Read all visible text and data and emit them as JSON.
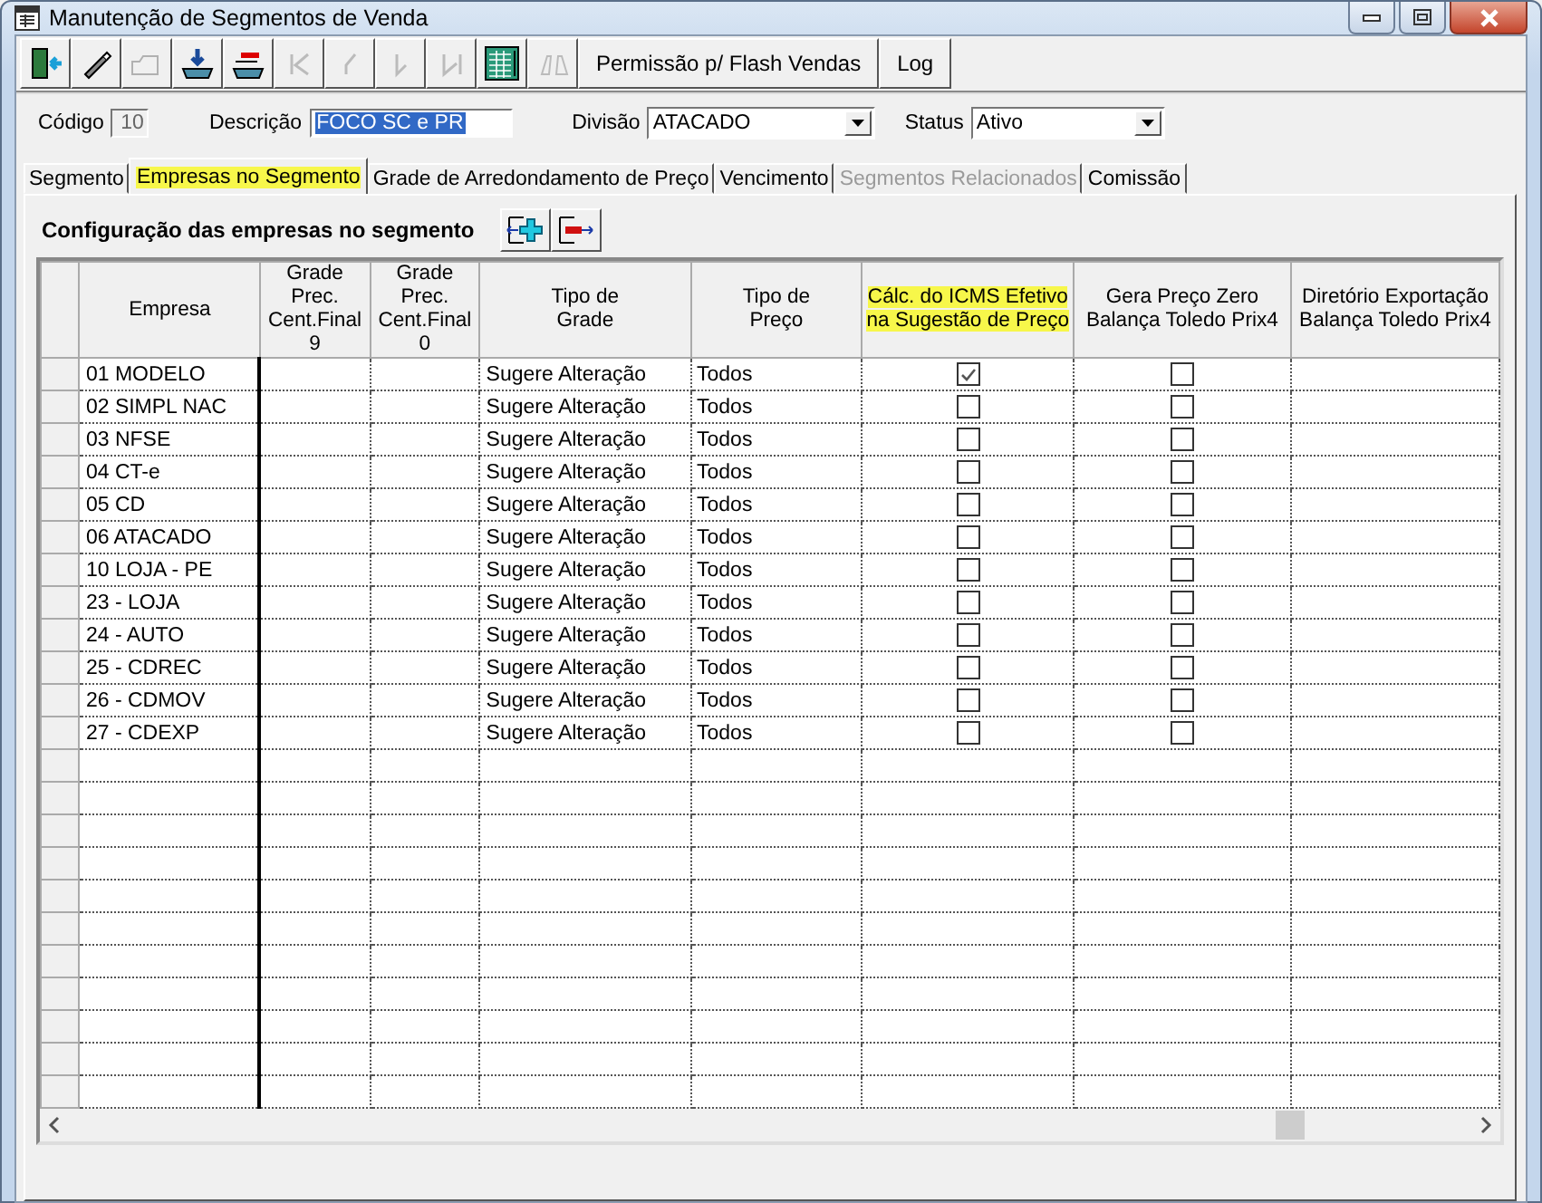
{
  "window": {
    "title": "Manutenção de Segmentos de Venda"
  },
  "toolbar": [
    {
      "kind": "icon",
      "disabled": false
    },
    {
      "kind": "icon",
      "disabled": false
    },
    {
      "kind": "icon",
      "disabled": true
    },
    {
      "kind": "icon",
      "disabled": false
    },
    {
      "kind": "icon",
      "disabled": false
    },
    {
      "kind": "icon",
      "disabled": true
    },
    {
      "kind": "icon",
      "disabled": true
    },
    {
      "kind": "icon",
      "disabled": true
    },
    {
      "kind": "icon",
      "disabled": true
    },
    {
      "kind": "icon",
      "disabled": false
    },
    {
      "kind": "icon",
      "disabled": true
    },
    {
      "kind": "text",
      "label": "Permissão p/ Flash Vendas"
    },
    {
      "kind": "text",
      "label": "Log"
    }
  ],
  "form": {
    "codigo_label": "Código",
    "codigo": "10",
    "descricao_label": "Descrição",
    "descricao": "FOCO SC e PR",
    "divisao_label": "Divisão",
    "divisao": "ATACADO",
    "status_label": "Status",
    "status": "Ativo"
  },
  "tabs": [
    {
      "label": "Segmento",
      "selected": false,
      "disabled": false,
      "highlighted": false
    },
    {
      "label": "Empresas no Segmento",
      "selected": true,
      "disabled": false,
      "highlighted": true
    },
    {
      "label": "Grade de Arredondamento de Preço",
      "selected": false,
      "disabled": false,
      "highlighted": false
    },
    {
      "label": "Vencimento",
      "selected": false,
      "disabled": false,
      "highlighted": false
    },
    {
      "label": "Segmentos Relacionados",
      "selected": false,
      "disabled": true,
      "highlighted": false
    },
    {
      "label": "Comissão",
      "selected": false,
      "disabled": false,
      "highlighted": false
    }
  ],
  "section_title": "Configuração das empresas no segmento",
  "table": {
    "columns": [
      {
        "label": "Empresa",
        "highlighted": false
      },
      {
        "label": "Grade Prec.\nCent.Final 9",
        "highlighted": false
      },
      {
        "label": "Grade Prec.\nCent.Final 0",
        "highlighted": false
      },
      {
        "label": "Tipo de\nGrade",
        "highlighted": false
      },
      {
        "label": "Tipo de\nPreço",
        "highlighted": false
      },
      {
        "label": "Cálc. do ICMS Efetivo\nna Sugestão de Preço",
        "highlighted": true
      },
      {
        "label": "Gera Preço Zero\nBalança Toledo Prix4",
        "highlighted": false
      },
      {
        "label": "Diretório Exportação\nBalança Toledo Prix4",
        "highlighted": false
      }
    ],
    "rows": [
      {
        "empresa": "01 MODELO",
        "tipo_grade": "Sugere Alteração",
        "tipo_preco": "Todos",
        "calc_icms": true,
        "gera_zero": false
      },
      {
        "empresa": "02 SIMPL NAC",
        "tipo_grade": "Sugere Alteração",
        "tipo_preco": "Todos",
        "calc_icms": false,
        "gera_zero": false
      },
      {
        "empresa": "03 NFSE",
        "tipo_grade": "Sugere Alteração",
        "tipo_preco": "Todos",
        "calc_icms": false,
        "gera_zero": false
      },
      {
        "empresa": "04 CT-e",
        "tipo_grade": "Sugere Alteração",
        "tipo_preco": "Todos",
        "calc_icms": false,
        "gera_zero": false
      },
      {
        "empresa": "05 CD",
        "tipo_grade": "Sugere Alteração",
        "tipo_preco": "Todos",
        "calc_icms": false,
        "gera_zero": false
      },
      {
        "empresa": "06 ATACADO",
        "tipo_grade": "Sugere Alteração",
        "tipo_preco": "Todos",
        "calc_icms": false,
        "gera_zero": false
      },
      {
        "empresa": "10 LOJA - PE",
        "tipo_grade": "Sugere Alteração",
        "tipo_preco": "Todos",
        "calc_icms": false,
        "gera_zero": false
      },
      {
        "empresa": "23 - LOJA",
        "tipo_grade": "Sugere Alteração",
        "tipo_preco": "Todos",
        "calc_icms": false,
        "gera_zero": false
      },
      {
        "empresa": "24 - AUTO",
        "tipo_grade": "Sugere Alteração",
        "tipo_preco": "Todos",
        "calc_icms": false,
        "gera_zero": false
      },
      {
        "empresa": "25 - CDREC",
        "tipo_grade": "Sugere Alteração",
        "tipo_preco": "Todos",
        "calc_icms": false,
        "gera_zero": false
      },
      {
        "empresa": "26 - CDMOV",
        "tipo_grade": "Sugere Alteração",
        "tipo_preco": "Todos",
        "calc_icms": false,
        "gera_zero": false
      },
      {
        "empresa": "27 - CDEXP",
        "tipo_grade": "Sugere Alteração",
        "tipo_preco": "Todos",
        "calc_icms": false,
        "gera_zero": false
      }
    ]
  }
}
